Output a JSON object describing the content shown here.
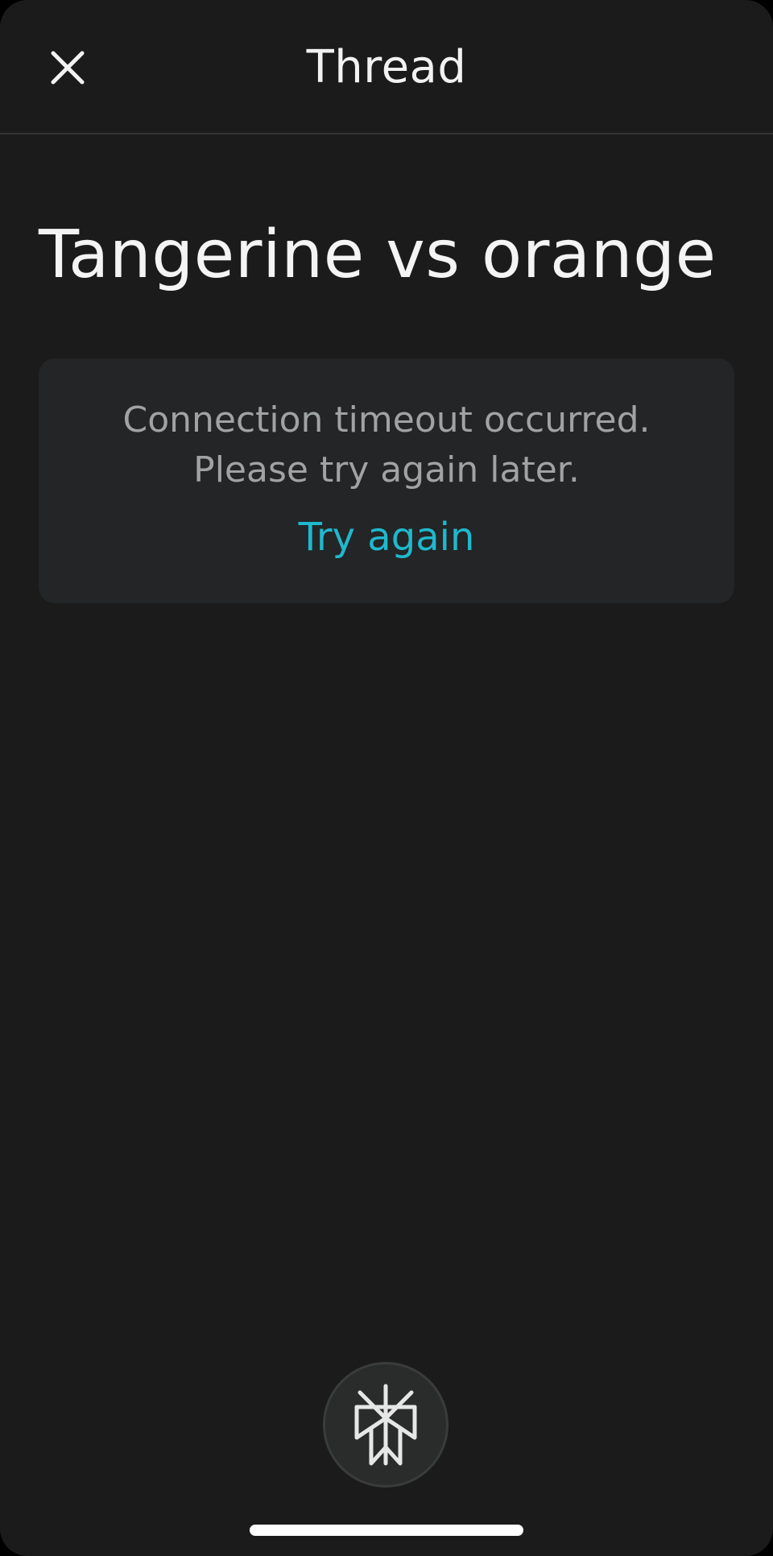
{
  "header": {
    "title": "Thread",
    "close_icon": "close-icon"
  },
  "thread": {
    "title": "Tangerine vs orange"
  },
  "error": {
    "line1": "Connection timeout occurred.",
    "line2": "Please try again later.",
    "retry_label": "Try again"
  },
  "fab": {
    "icon": "perplexity-logo-icon"
  },
  "colors": {
    "background": "#1b1b1b",
    "card": "#232526",
    "text": "#f4f4f4",
    "muted_text": "#9fa3a3",
    "accent": "#20b8cd"
  }
}
